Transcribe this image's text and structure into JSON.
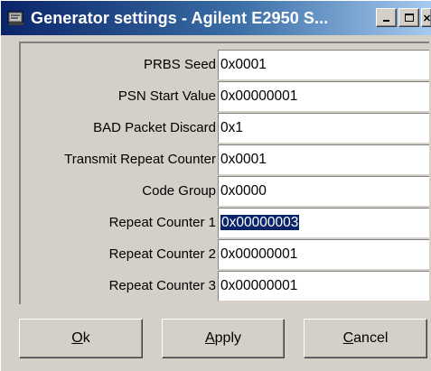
{
  "window": {
    "title": "Generator settings - Agilent E2950 S..."
  },
  "fields": [
    {
      "label": "PRBS Seed",
      "value": "0x0001"
    },
    {
      "label": "PSN Start Value",
      "value": "0x00000001"
    },
    {
      "label": "BAD Packet Discard",
      "value": "0x1"
    },
    {
      "label": "Transmit Repeat Counter",
      "value": "0x0001"
    },
    {
      "label": "Code Group",
      "value": "0x0000"
    },
    {
      "label": "Repeat Counter 1",
      "value": "0x00000003"
    },
    {
      "label": "Repeat Counter 2",
      "value": "0x00000001"
    },
    {
      "label": "Repeat Counter 3",
      "value": "0x00000001"
    }
  ],
  "buttons": {
    "ok": {
      "mnemonic": "O",
      "rest": "k"
    },
    "apply": {
      "mnemonic": "A",
      "rest": "pply"
    },
    "cancel": {
      "mnemonic": "C",
      "rest": "ancel"
    }
  },
  "colors": {
    "titlebar_start": "#0a246a",
    "titlebar_end": "#a6caf0",
    "face": "#d4d0c8",
    "selection": "#0a246a"
  },
  "icons": [
    "app-icon",
    "minimize-icon",
    "maximize-icon",
    "close-icon"
  ]
}
